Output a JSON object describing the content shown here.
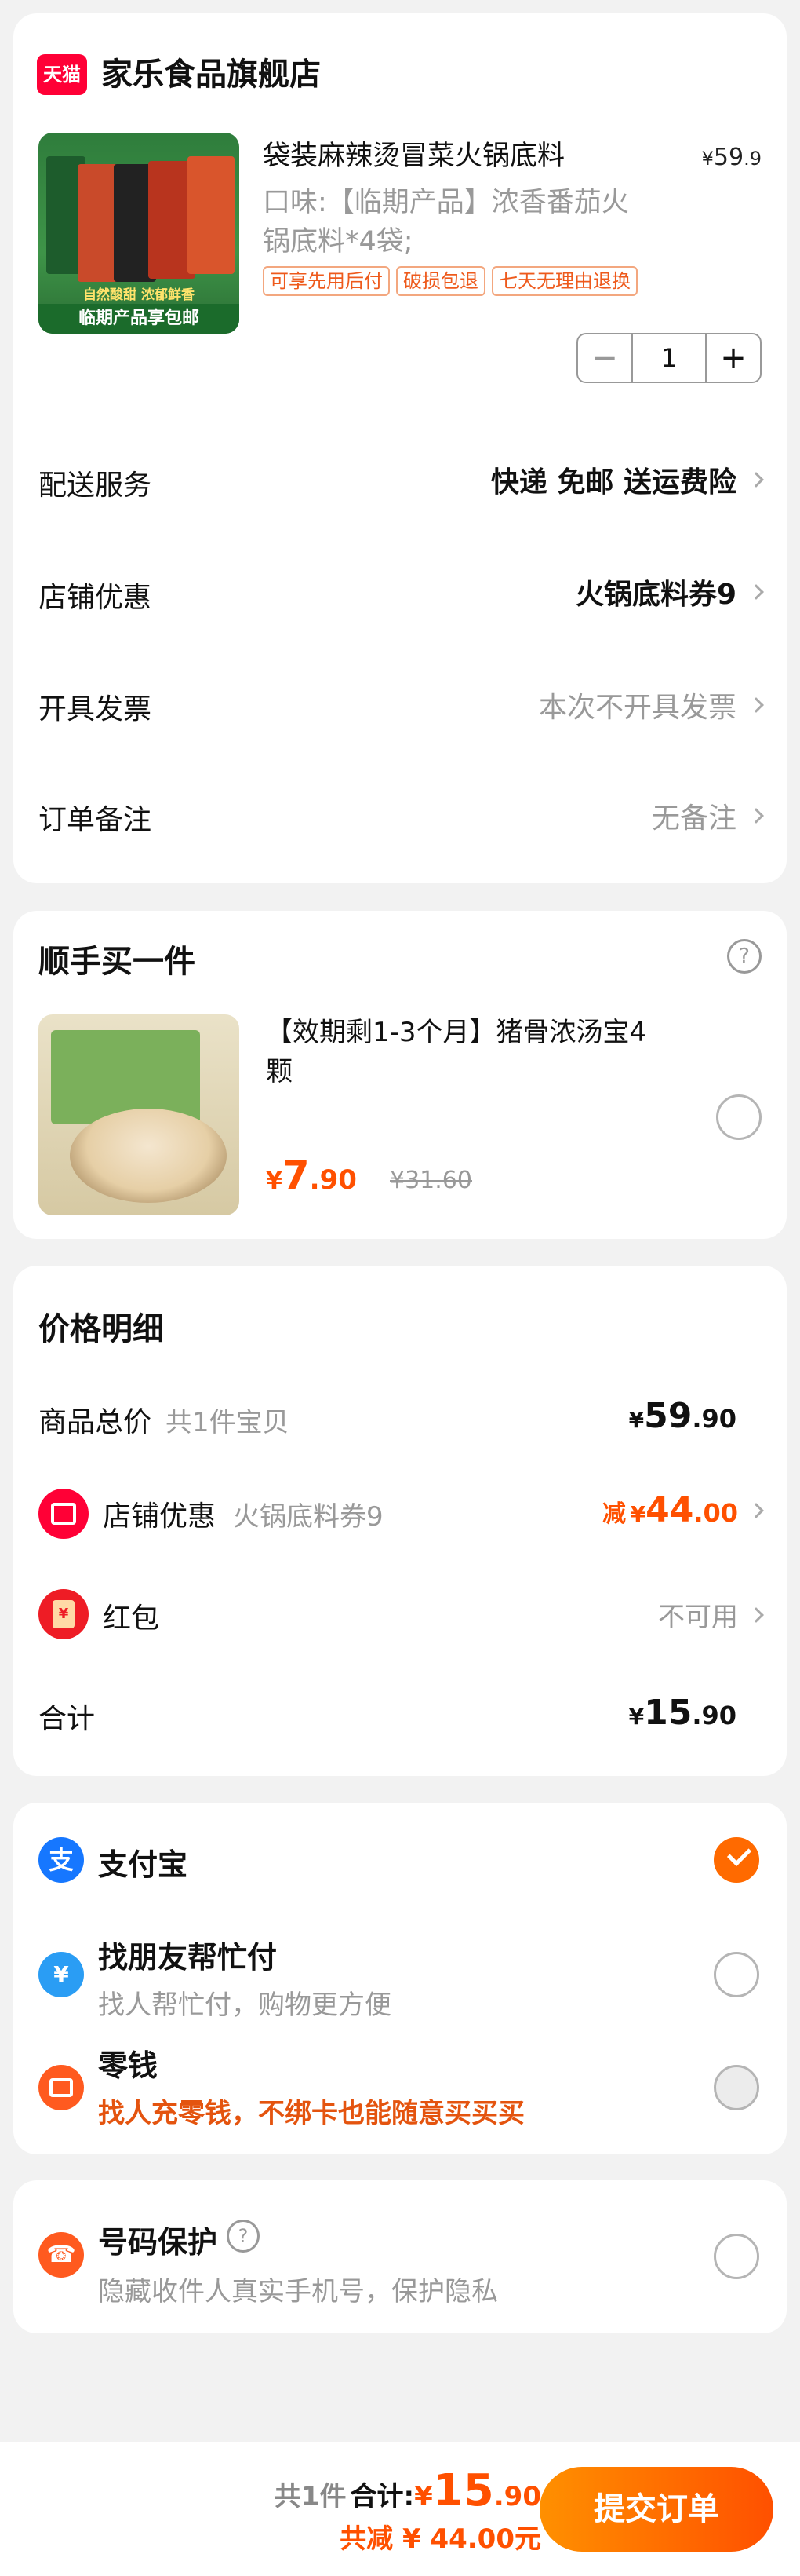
{
  "shop": {
    "logo_text": "天猫",
    "name": "家乐食品旗舰店"
  },
  "product": {
    "title": "袋装麻辣烫冒菜火锅底料",
    "price_symbol": "¥",
    "price_int": "59",
    "price_dec": ".9",
    "spec_line1": "口味:【临期产品】浓香番茄火",
    "spec_line2": "锅底料*4袋;",
    "tags": [
      "可享先用后付",
      "破损包退",
      "七天无理由退换"
    ],
    "image_banner1": "自然酸甜 浓郁鲜香",
    "image_banner2": "临期产品享包邮",
    "quantity": "1",
    "minus": "−",
    "plus": "+"
  },
  "order_rows": {
    "delivery": {
      "label": "配送服务",
      "value": "快递 免邮 送运费险"
    },
    "discount": {
      "label": "店铺优惠",
      "value": "火锅底料券9"
    },
    "invoice": {
      "label": "开具发票",
      "value": "本次不开具发票"
    },
    "note": {
      "label": "订单备注",
      "value": "无备注"
    }
  },
  "addon": {
    "section_title": "顺手买一件",
    "help_icon": "?",
    "title_line1": "【效期剩1-3个月】猪骨浓汤宝4",
    "title_line2": "颗",
    "price_symbol": "¥",
    "price_int": "7",
    "price_dec": ".90",
    "original_price": "¥31.60"
  },
  "price_detail": {
    "section_title": "价格明细",
    "goods_label": "商品总价",
    "goods_count": "共1件宝贝",
    "goods_symbol": "¥",
    "goods_int": "59",
    "goods_dec": ".90",
    "shop_discount_label": "店铺优惠",
    "shop_discount_sub": "火锅底料券9",
    "shop_discount_prefix": "减",
    "shop_discount_symbol": "¥",
    "shop_discount_int": "44",
    "shop_discount_dec": ".00",
    "redpacket_label": "红包",
    "redpacket_value": "不可用",
    "total_label": "合计",
    "total_symbol": "¥",
    "total_int": "15",
    "total_dec": ".90"
  },
  "payment": {
    "alipay": {
      "label": "支付宝",
      "icon_text": "支"
    },
    "friend": {
      "label": "找朋友帮忙付",
      "sub": "找人帮忙付，购物更方便",
      "icon_text": "¥"
    },
    "change": {
      "label": "零钱",
      "sub": "找人充零钱，不绑卡也能随意买买买"
    }
  },
  "privacy": {
    "label": "号码保护",
    "help_icon": "?",
    "sub": "隐藏收件人真实手机号，保护隐私"
  },
  "bottom_bar": {
    "count_text": "共1件",
    "total_label": "合计:",
    "total_symbol": "¥",
    "total_int": "15",
    "total_dec": ".90",
    "saved_text": "共减 ¥ 44.00元",
    "submit_label": "提交订单"
  },
  "colors": {
    "accent": "#ff5000",
    "tmall_red": "#ff0036",
    "alipay_blue": "#1677ff",
    "background": "#f2f2f2"
  }
}
